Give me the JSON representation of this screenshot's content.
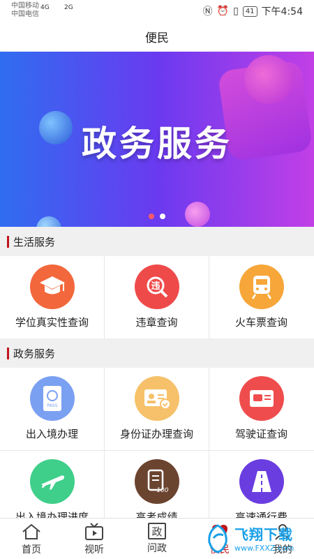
{
  "status_bar": {
    "carrier1": "中国移动",
    "carrier2": "中国电信",
    "net1": "4G",
    "net2": "2G",
    "battery": "41",
    "time": "下午4:54"
  },
  "header": {
    "title": "便民"
  },
  "banner": {
    "title": "政务服务",
    "slide_count": 2,
    "active_slide": 1
  },
  "sections": [
    {
      "title": "生活服务",
      "items": [
        {
          "label": "学位真实性查询",
          "icon": "graduation-cap-icon",
          "color": "#f2683c"
        },
        {
          "label": "违章查询",
          "icon": "violation-search-icon",
          "color": "#ef4a4a"
        },
        {
          "label": "火车票查询",
          "icon": "train-icon",
          "color": "#f7a63a"
        }
      ]
    },
    {
      "title": "政务服务",
      "items": [
        {
          "label": "出入境办理",
          "icon": "passport-icon",
          "color": "#7aa0f2"
        },
        {
          "label": "身份证办理查询",
          "icon": "id-card-icon",
          "color": "#f6c16a"
        },
        {
          "label": "驾驶证查询",
          "icon": "driver-license-icon",
          "color": "#ef4d4d"
        },
        {
          "label": "出入境办理进度",
          "icon": "airplane-icon",
          "color": "#3fcf8a"
        },
        {
          "label": "高考成绩",
          "icon": "exam-score-icon",
          "color": "#6b4430"
        },
        {
          "label": "高速通行费",
          "icon": "highway-icon",
          "color": "#6a3de0"
        }
      ]
    }
  ],
  "tabs": [
    {
      "label": "首页",
      "icon": "home-icon"
    },
    {
      "label": "视听",
      "icon": "tv-icon"
    },
    {
      "label": "问政",
      "icon": "ask-gov-icon",
      "glyph": "政"
    },
    {
      "label": "便民",
      "icon": "convenience-icon",
      "active": true
    },
    {
      "label": "我的",
      "icon": "user-icon"
    }
  ],
  "watermark": {
    "text": "飞翔下载",
    "url": "www.FXXZ.com"
  },
  "colors": {
    "accent": "#c0141b",
    "banner_start": "#2f6df0",
    "banner_end": "#c23fe6"
  }
}
